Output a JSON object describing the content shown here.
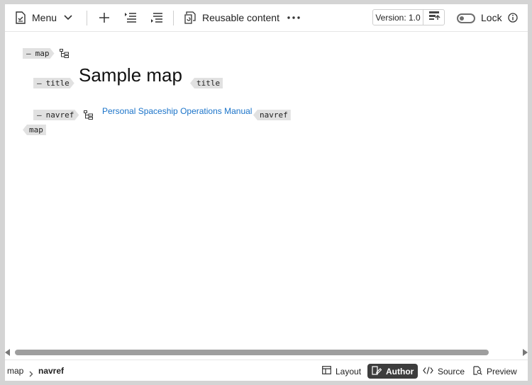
{
  "toolbar": {
    "menu_label": "Menu",
    "reusable_label": "Reusable content",
    "version_label": "Version: 1.0",
    "lock_label": "Lock",
    "lock_enabled": false
  },
  "document": {
    "map_tag": "map",
    "title_tag": "title",
    "title_text": "Sample map",
    "navref_tag": "navref",
    "navref_link": "Personal Spaceship Operations Manual",
    "dash": "—"
  },
  "statusbar": {
    "breadcrumbs": [
      "map",
      "navref"
    ],
    "views": [
      "Layout",
      "Author",
      "Source",
      "Preview"
    ],
    "selected_view": "Author"
  },
  "colors": {
    "link": "#1a73c9",
    "tag_bg": "#e1e1e1",
    "selected_view_bg": "#3d3d3d"
  }
}
